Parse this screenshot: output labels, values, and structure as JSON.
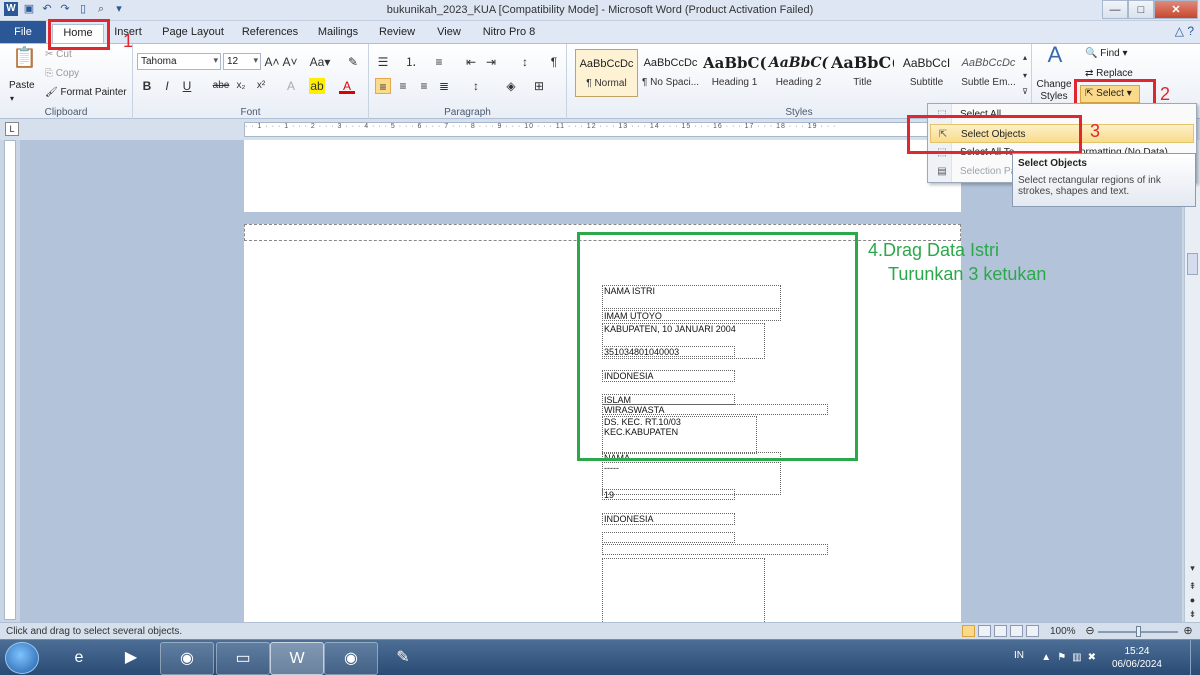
{
  "window": {
    "title": "bukunikah_2023_KUA [Compatibility Mode] - Microsoft Word (Product Activation Failed)",
    "controls": [
      "—",
      "□",
      "✕"
    ]
  },
  "qat_icons": [
    "word-app-icon",
    "save-icon",
    "undo-icon",
    "redo-icon",
    "new-document-icon",
    "print-preview-icon",
    "qat-dropdown-icon"
  ],
  "tabs": [
    "File",
    "Home",
    "Insert",
    "Page Layout",
    "References",
    "Mailings",
    "Review",
    "View",
    "Nitro Pro 8"
  ],
  "active_tab": "Home",
  "ribbon": {
    "clipboard": {
      "paste": "Paste",
      "cut": "Cut",
      "copy": "Copy",
      "format_painter": "Format Painter",
      "label": "Clipboard"
    },
    "font": {
      "name": "Tahoma",
      "size": "12",
      "label": "Font",
      "buttons": [
        "B",
        "I",
        "U",
        "abe",
        "x₂",
        "x²"
      ]
    },
    "paragraph": {
      "label": "Paragraph"
    },
    "styles": {
      "label": "Styles",
      "items": [
        {
          "preview": "AaBbCcDc",
          "name": "¶ Normal"
        },
        {
          "preview": "AaBbCcDc",
          "name": "¶ No Spaci..."
        },
        {
          "preview": "AaBbC(",
          "name": "Heading 1"
        },
        {
          "preview": "AaBbC(",
          "name": "Heading 2"
        },
        {
          "preview": "AaBbC(",
          "name": "Title"
        },
        {
          "preview": "AaBbCcI",
          "name": "Subtitle"
        },
        {
          "preview": "AaBbCcDc",
          "name": "Subtle Em..."
        }
      ],
      "change_styles": "Change Styles"
    },
    "editing": {
      "find": "Find",
      "replace": "Replace",
      "select": "Select"
    }
  },
  "annotations": {
    "n1": "1",
    "n2": "2",
    "n3": "3",
    "step4_line1": "4.Drag Data Istri",
    "step4_line2": "Turunkan 3 ketukan"
  },
  "select_menu": {
    "items": [
      {
        "label": "Select All",
        "state": "partial"
      },
      {
        "label": "Select Objects",
        "state": "highlighted"
      },
      {
        "label": "Select All Te",
        "state": "partial"
      },
      {
        "label": "Selection Pa",
        "state": "disabled"
      }
    ],
    "peek_text": "ormatting (No Data)"
  },
  "tooltip": {
    "title": "Select Objects",
    "body": "Select rectangular regions of ink strokes, shapes and text."
  },
  "document_fields": [
    "NAMA ISTRI",
    "IMAM UTOYO",
    "KABUPATEN, 10 JANUARI 2004",
    "351034801040003",
    "INDONESIA",
    "ISLAM",
    "WIRASWASTA",
    "DS. KEC. RT.10/03 KEC.KABUPATEN",
    "NAMA",
    "-----",
    "19",
    "INDONESIA"
  ],
  "statusbar": {
    "message": "Click and drag to select several objects.",
    "zoom": "100%",
    "zoom_level_pct": 100
  },
  "taskbar": {
    "apps": [
      "ie-icon",
      "media-player-icon",
      "chrome-icon",
      "explorer-folder-icon",
      "word-icon",
      "chrome-icon",
      "paint-icon"
    ],
    "lang": "IN",
    "time": "15:24",
    "date": "06/06/2024"
  }
}
